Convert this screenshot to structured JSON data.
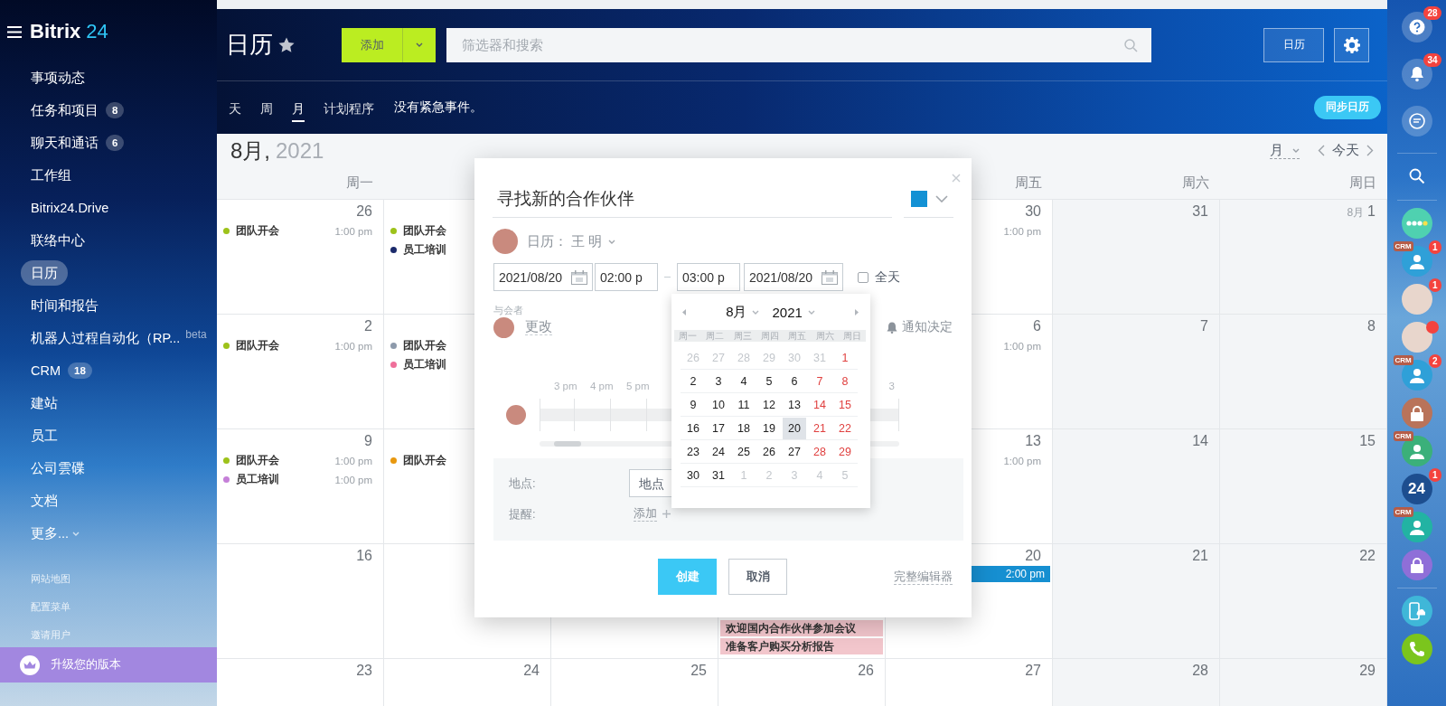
{
  "sidebar": {
    "logo": {
      "brand": "Bitrix",
      "number": "24"
    },
    "items": [
      {
        "label": "事项动态",
        "selected": false
      },
      {
        "label": "任务和项目",
        "badge": "8",
        "selected": false
      },
      {
        "label": "聊天和通话",
        "badge": "6",
        "selected": false
      },
      {
        "label": "工作组",
        "selected": false
      },
      {
        "label": "Bitrix24.Drive",
        "selected": false
      },
      {
        "label": "联络中心",
        "selected": false
      },
      {
        "label": "日历",
        "selected": true
      },
      {
        "label": "时间和报告",
        "selected": false
      },
      {
        "label": "机器人过程自动化（RP...",
        "tag": "beta",
        "selected": false
      },
      {
        "label": "CRM",
        "badge": "18",
        "selected": false
      },
      {
        "label": "建站",
        "selected": false
      },
      {
        "label": "员工",
        "selected": false
      },
      {
        "label": "公司雲碟",
        "selected": false
      },
      {
        "label": "文档",
        "selected": false
      }
    ],
    "more": "更多...",
    "footer_links": [
      "网站地图",
      "配置菜单",
      "邀请用户"
    ],
    "upgrade": "升级您的版本"
  },
  "header": {
    "title": "日历",
    "add_button": "添加",
    "search": {
      "placeholder": "筛选器和搜索"
    },
    "calendar_button": "日历",
    "tabs": [
      {
        "label": "天",
        "selected": false
      },
      {
        "label": "周",
        "selected": false
      },
      {
        "label": "月",
        "selected": true
      },
      {
        "label": "计划程序",
        "selected": false
      }
    ],
    "notice": "没有紧急事件。",
    "sync_button": "同步日历"
  },
  "calendar": {
    "month": "8月,",
    "year": "2021",
    "view": "月",
    "today": "今天",
    "weekdays": {
      "mon": "周一",
      "fri": "周五",
      "sat": "周六",
      "sun": "周日"
    },
    "weeks": [
      {
        "mon": {
          "day": "26",
          "events": [
            {
              "kind": "dot",
              "title": "团队开会",
              "time": "1:00 pm",
              "color": "#9dc21a"
            }
          ]
        },
        "tue": {
          "events": [
            {
              "kind": "dot",
              "title": "团队开会",
              "color": "#9dc21a"
            },
            {
              "kind": "dot",
              "title": "员工培训",
              "color": "#1b2a6b"
            }
          ]
        },
        "fri": {
          "day": "30",
          "events": [
            {
              "kind": "time",
              "time": "1:00 pm"
            }
          ]
        },
        "sat": {
          "day": "31"
        },
        "sun": {
          "prefix": "8月",
          "day": "1"
        }
      },
      {
        "mon": {
          "day": "2",
          "events": [
            {
              "kind": "dot",
              "title": "团队开会",
              "time": "1:00 pm",
              "color": "#9dc21a"
            }
          ]
        },
        "tue": {
          "events": [
            {
              "kind": "dot",
              "title": "团队开会",
              "color": "#8d9aab"
            },
            {
              "kind": "dot",
              "title": "员工培训",
              "color": "#ef6f9a"
            }
          ]
        },
        "fri": {
          "day": "6",
          "events": [
            {
              "kind": "time",
              "time": "1:00 pm"
            }
          ]
        },
        "sat": {
          "day": "7"
        },
        "sun": {
          "day": "8"
        }
      },
      {
        "mon": {
          "day": "9",
          "events": [
            {
              "kind": "dot",
              "title": "团队开会",
              "time": "1:00 pm",
              "color": "#9dc21a"
            },
            {
              "kind": "dot",
              "title": "员工培训",
              "time": "1:00 pm",
              "color": "#c57fd8"
            }
          ]
        },
        "tue": {
          "events": [
            {
              "kind": "dot",
              "title": "团队开会",
              "color": "#e8980f"
            }
          ]
        },
        "fri": {
          "day": "13",
          "events": [
            {
              "kind": "time",
              "time": "1:00 pm"
            }
          ]
        },
        "sat": {
          "day": "14"
        },
        "sun": {
          "day": "15"
        }
      },
      {
        "mon": {
          "day": "16"
        },
        "thu": {
          "events": [
            {
              "kind": "bar",
              "title": "欢迎国内合作伙伴参加会议",
              "color": "#f2c6cc"
            },
            {
              "kind": "bar",
              "title": "准备客户购买分析报告",
              "color": "#f2c6cc"
            }
          ]
        },
        "fri": {
          "day": "20",
          "events": [
            {
              "kind": "bar",
              "time": "2:00 pm",
              "color": "#168fd1"
            }
          ]
        },
        "sat": {
          "day": "21"
        },
        "sun": {
          "day": "22"
        }
      },
      {
        "mon": {
          "day": "23"
        },
        "tue": {
          "day": "24"
        },
        "wed": {
          "day": "25"
        },
        "thu": {
          "day": "26"
        },
        "fri": {
          "day": "27"
        },
        "sat": {
          "day": "28"
        },
        "sun": {
          "day": "29"
        }
      }
    ]
  },
  "popup": {
    "title": "寻找新的合作伙伴",
    "color": "#1391d4",
    "owner": {
      "label": "日历：",
      "name": "王 明"
    },
    "start_date": "2021/08/20",
    "start_time": "02:00 p",
    "end_time": "03:00 p",
    "end_date": "2021/08/20",
    "all_day": {
      "label": "全天",
      "checked": false
    },
    "attendees_label": "与会者",
    "change_link": "更改",
    "notify": "通知决定",
    "timeline": [
      "3 pm",
      "4 pm",
      "5 pm"
    ],
    "timeline_tail": "3",
    "location": {
      "label": "地点:",
      "placeholder": "地点"
    },
    "reminder": {
      "label": "提醒:",
      "link": "添加"
    },
    "create_button": "创建",
    "cancel_button": "取消",
    "full_editor": "完整编辑器",
    "datepicker": {
      "month": "8月",
      "year": "2021",
      "weekdays": [
        "周一",
        "周二",
        "周三",
        "周四",
        "周五",
        "周六",
        "周日"
      ],
      "days": [
        {
          "day": "26",
          "kind": "other",
          "selected": false
        },
        {
          "day": "27",
          "kind": "other",
          "selected": false
        },
        {
          "day": "28",
          "kind": "other",
          "selected": false
        },
        {
          "day": "29",
          "kind": "other",
          "selected": false
        },
        {
          "day": "30",
          "kind": "other",
          "selected": false
        },
        {
          "day": "31",
          "kind": "other",
          "selected": false
        },
        {
          "day": "1",
          "kind": "weekend",
          "selected": false
        },
        {
          "day": "2",
          "kind": "weekday",
          "selected": false
        },
        {
          "day": "3",
          "kind": "weekday",
          "selected": false
        },
        {
          "day": "4",
          "kind": "weekday",
          "selected": false
        },
        {
          "day": "5",
          "kind": "weekday",
          "selected": false
        },
        {
          "day": "6",
          "kind": "weekday",
          "selected": false
        },
        {
          "day": "7",
          "kind": "weekend",
          "selected": false
        },
        {
          "day": "8",
          "kind": "weekend",
          "selected": false
        },
        {
          "day": "9",
          "kind": "weekday",
          "selected": false
        },
        {
          "day": "10",
          "kind": "weekday",
          "selected": false
        },
        {
          "day": "11",
          "kind": "weekday",
          "selected": false
        },
        {
          "day": "12",
          "kind": "weekday",
          "selected": false
        },
        {
          "day": "13",
          "kind": "weekday",
          "selected": false
        },
        {
          "day": "14",
          "kind": "weekend",
          "selected": false
        },
        {
          "day": "15",
          "kind": "weekend",
          "selected": false
        },
        {
          "day": "16",
          "kind": "weekday",
          "selected": false
        },
        {
          "day": "17",
          "kind": "weekday",
          "selected": false
        },
        {
          "day": "18",
          "kind": "weekday",
          "selected": false
        },
        {
          "day": "19",
          "kind": "weekday",
          "selected": false
        },
        {
          "day": "20",
          "kind": "weekday",
          "selected": true
        },
        {
          "day": "21",
          "kind": "weekend",
          "selected": false
        },
        {
          "day": "22",
          "kind": "weekend",
          "selected": false
        },
        {
          "day": "23",
          "kind": "weekday",
          "selected": false
        },
        {
          "day": "24",
          "kind": "weekday",
          "selected": false
        },
        {
          "day": "25",
          "kind": "weekday",
          "selected": false
        },
        {
          "day": "26",
          "kind": "weekday",
          "selected": false
        },
        {
          "day": "27",
          "kind": "weekday",
          "selected": false
        },
        {
          "day": "28",
          "kind": "weekend",
          "selected": false
        },
        {
          "day": "29",
          "kind": "weekend",
          "selected": false
        },
        {
          "day": "30",
          "kind": "weekday",
          "selected": false
        },
        {
          "day": "31",
          "kind": "weekday",
          "selected": false
        },
        {
          "day": "1",
          "kind": "other",
          "selected": false
        },
        {
          "day": "2",
          "kind": "other",
          "selected": false
        },
        {
          "day": "3",
          "kind": "other",
          "selected": false
        },
        {
          "day": "4",
          "kind": "other",
          "selected": false
        },
        {
          "day": "5",
          "kind": "other",
          "selected": false
        }
      ]
    }
  },
  "rightbar": {
    "items": [
      {
        "kind": "help",
        "counter": "28"
      },
      {
        "kind": "bell",
        "counter": "34"
      },
      {
        "kind": "chat"
      },
      {
        "kind": "search"
      },
      {
        "kind": "dots",
        "color": "#4fd1b0"
      },
      {
        "kind": "user",
        "tag": "CRM",
        "counter": "1",
        "color": "#2fa0d8"
      },
      {
        "kind": "photo",
        "counter": "1",
        "unread": false
      },
      {
        "kind": "photo",
        "unread": true
      },
      {
        "kind": "user",
        "tag": "CRM",
        "counter": "2",
        "color": "#2fa0d8"
      },
      {
        "kind": "lock",
        "color": "#b9735a"
      },
      {
        "kind": "user",
        "tag": "CRM",
        "color": "#3bb07a"
      },
      {
        "kind": "logo",
        "label": "24",
        "counter": "1",
        "color": "#1d4e8f"
      },
      {
        "kind": "user",
        "tag": "CRM",
        "color": "#22b3a3"
      },
      {
        "kind": "lock",
        "color": "#8f6fd8"
      },
      {
        "kind": "mobile",
        "color": "#3fb7d8"
      },
      {
        "kind": "call",
        "color": "#7bc51d"
      }
    ]
  }
}
